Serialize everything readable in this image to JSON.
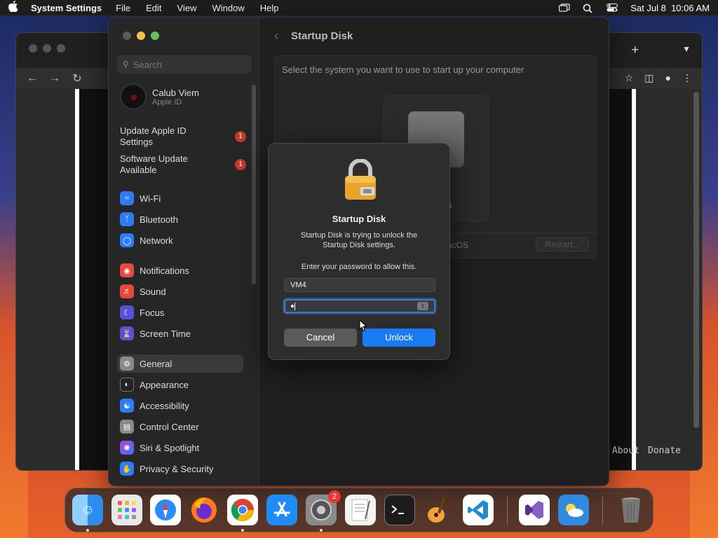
{
  "menubar": {
    "app_name": "System Settings",
    "menus": [
      "File",
      "Edit",
      "View",
      "Window",
      "Help"
    ],
    "datetime": "Sat Jul 8  10:06 AM"
  },
  "browser": {
    "footer_links": [
      "About",
      "Donate"
    ]
  },
  "settings": {
    "search_placeholder": "Search",
    "profile": {
      "name": "Calub Viem",
      "subtitle": "Apple ID"
    },
    "notices": [
      {
        "label_line1": "Update Apple ID",
        "label_line2": "Settings",
        "badge": "1"
      },
      {
        "label_line1": "Software Update",
        "label_line2": "Available",
        "badge": "1"
      }
    ],
    "sidebar_items": [
      {
        "label": "Wi-Fi",
        "icon": "wifi-icon",
        "color": "#2b7cf6"
      },
      {
        "label": "Bluetooth",
        "icon": "bluetooth-icon",
        "color": "#2b7cf6"
      },
      {
        "label": "Network",
        "icon": "globe-icon",
        "color": "#2b7cf6"
      },
      {
        "label": "Notifications",
        "icon": "bell-icon",
        "color": "#e5483d"
      },
      {
        "label": "Sound",
        "icon": "speaker-icon",
        "color": "#e5483d"
      },
      {
        "label": "Focus",
        "icon": "moon-icon",
        "color": "#5b4fd6"
      },
      {
        "label": "Screen Time",
        "icon": "hourglass-icon",
        "color": "#5b4fd6"
      },
      {
        "label": "General",
        "icon": "gear-icon",
        "color": "#8a8a8a"
      },
      {
        "label": "Appearance",
        "icon": "appearance-icon",
        "color": "#222222"
      },
      {
        "label": "Accessibility",
        "icon": "accessibility-icon",
        "color": "#2b7cf6"
      },
      {
        "label": "Control Center",
        "icon": "control-center-icon",
        "color": "#8a8a8a"
      },
      {
        "label": "Siri & Spotlight",
        "icon": "siri-icon",
        "color": "#c03ad8"
      },
      {
        "label": "Privacy & Security",
        "icon": "hand-icon",
        "color": "#2b7cf6"
      }
    ],
    "main": {
      "title": "Startup Disk",
      "prompt": "Select the system you want to use to start up your computer",
      "disk_version": "4",
      "os_label": "acOS",
      "restart_label": "Restart..."
    }
  },
  "dialog": {
    "title": "Startup Disk",
    "message_line1": "Startup Disk is trying to unlock the",
    "message_line2": "Startup Disk settings.",
    "prompt": "Enter your password to allow this.",
    "username": "VM4",
    "cancel_label": "Cancel",
    "unlock_label": "Unlock"
  },
  "dock": {
    "items": [
      {
        "name": "finder",
        "icon": "finder-icon",
        "color": "#2d8cf0"
      },
      {
        "name": "launchpad",
        "icon": "launchpad-icon",
        "color": "#e8e8e8"
      },
      {
        "name": "safari",
        "icon": "safari-icon",
        "color": "#ffffff"
      },
      {
        "name": "firefox",
        "icon": "firefox-icon",
        "color": "#ff7a1a"
      },
      {
        "name": "chrome",
        "icon": "chrome-icon",
        "color": "#ffffff"
      },
      {
        "name": "app-store",
        "icon": "app-store-icon",
        "color": "#1f8cf5"
      },
      {
        "name": "system-settings",
        "icon": "system-settings-icon",
        "color": "#8a8a8a",
        "badge": "2"
      },
      {
        "name": "textedit",
        "icon": "textedit-icon",
        "color": "#f4f4f4"
      },
      {
        "name": "terminal",
        "icon": "terminal-icon",
        "color": "#1c1c1c"
      },
      {
        "name": "garageband",
        "icon": "garageband-icon",
        "color": "#f2a23a"
      },
      {
        "name": "vscode",
        "icon": "vscode-icon",
        "color": "#ffffff"
      },
      {
        "name": "visual-studio",
        "icon": "visual-studio-icon",
        "color": "#ffffff"
      },
      {
        "name": "weather",
        "icon": "weather-icon",
        "color": "#2f8ae0"
      },
      {
        "name": "trash",
        "icon": "trash-icon",
        "color": "#777777"
      }
    ]
  }
}
